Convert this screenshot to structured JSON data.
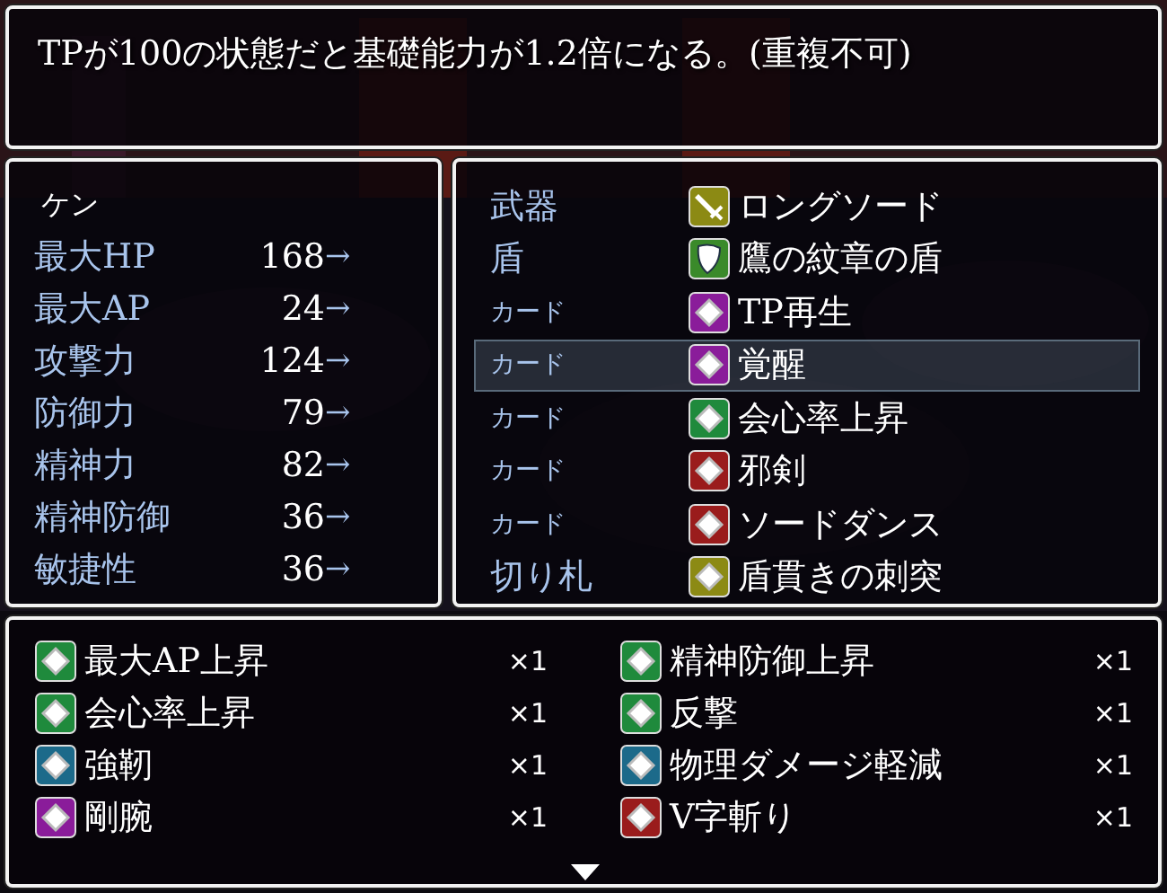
{
  "help": {
    "text": "TPが100の状態だと基礎能力が1.2倍になる。(重複不可)"
  },
  "status": {
    "actor": "ケン",
    "stats": [
      {
        "label": "最大HP",
        "value": "168",
        "arrow": "→"
      },
      {
        "label": "最大AP",
        "value": "24",
        "arrow": "→"
      },
      {
        "label": "攻撃力",
        "value": "124",
        "arrow": "→"
      },
      {
        "label": "防御力",
        "value": "79",
        "arrow": "→"
      },
      {
        "label": "精神力",
        "value": "82",
        "arrow": "→"
      },
      {
        "label": "精神防御",
        "value": "36",
        "arrow": "→"
      },
      {
        "label": "敏捷性",
        "value": "36",
        "arrow": "→"
      }
    ]
  },
  "equipment": {
    "slots": [
      {
        "slot": "武器",
        "kind": "equip",
        "color": "#8c8a14",
        "item": "ロングソード",
        "selected": false
      },
      {
        "slot": "盾",
        "kind": "equip",
        "color": "#3a8a2a",
        "item": "鷹の紋章の盾",
        "selected": false
      },
      {
        "slot": "カード",
        "kind": "card",
        "color": "#8a1c9a",
        "item": "TP再生",
        "selected": false
      },
      {
        "slot": "カード",
        "kind": "card",
        "color": "#8a1c9a",
        "item": "覚醒",
        "selected": true
      },
      {
        "slot": "カード",
        "kind": "card",
        "color": "#1f8a3c",
        "item": "会心率上昇",
        "selected": false
      },
      {
        "slot": "カード",
        "kind": "card",
        "color": "#9a1c1c",
        "item": "邪剣",
        "selected": false
      },
      {
        "slot": "カード",
        "kind": "card",
        "color": "#9a1c1c",
        "item": "ソードダンス",
        "selected": false
      },
      {
        "slot": "切り札",
        "kind": "equip",
        "color": "#8c8a14",
        "item": "盾貫きの刺突",
        "selected": false
      }
    ]
  },
  "inventory": {
    "items": [
      {
        "name": "最大AP上昇",
        "color": "#1f8a3c",
        "count": "×1"
      },
      {
        "name": "精神防御上昇",
        "color": "#1f8a3c",
        "count": "×1"
      },
      {
        "name": "会心率上昇",
        "color": "#1f8a3c",
        "count": "×1"
      },
      {
        "name": "反撃",
        "color": "#1f8a3c",
        "count": "×1"
      },
      {
        "name": "強靭",
        "color": "#1c6a8a",
        "count": "×1"
      },
      {
        "name": "物理ダメージ軽減",
        "color": "#1c6a8a",
        "count": "×1"
      },
      {
        "name": "剛腕",
        "color": "#8a1c9a",
        "count": "×1"
      },
      {
        "name": "V字斬り",
        "color": "#9a1c1c",
        "count": "×1"
      }
    ],
    "more_below": true
  }
}
